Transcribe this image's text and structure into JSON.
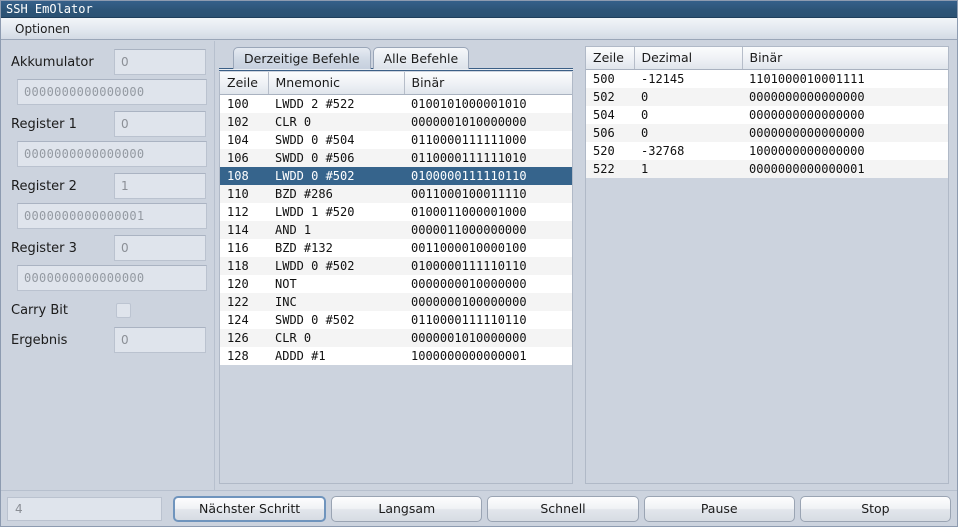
{
  "window": {
    "title": "SSH EmOlator"
  },
  "menubar": {
    "items": [
      {
        "label": "Optionen"
      }
    ]
  },
  "registers": {
    "rows": [
      {
        "label": "Akkumulator",
        "value": "0",
        "binary": "0000000000000000"
      },
      {
        "label": "Register 1",
        "value": "0",
        "binary": "0000000000000000"
      },
      {
        "label": "Register 2",
        "value": "1",
        "binary": "0000000000000001"
      },
      {
        "label": "Register 3",
        "value": "0",
        "binary": "0000000000000000"
      }
    ],
    "carry": {
      "label": "Carry Bit",
      "checked": false
    },
    "result": {
      "label": "Ergebnis",
      "value": "0"
    }
  },
  "tabs": [
    {
      "label": "Derzeitige Befehle",
      "active": true
    },
    {
      "label": "Alle Befehle",
      "active": false
    }
  ],
  "instructions": {
    "headers": [
      "Zeile",
      "Mnemonic",
      "Binär"
    ],
    "rows": [
      {
        "zeile": "100",
        "mnemonic": "LWDD 2 #522",
        "binaer": "0100101000001010",
        "selected": false
      },
      {
        "zeile": "102",
        "mnemonic": "CLR 0",
        "binaer": "0000001010000000",
        "selected": false
      },
      {
        "zeile": "104",
        "mnemonic": "SWDD 0 #504",
        "binaer": "0110000111111000",
        "selected": false
      },
      {
        "zeile": "106",
        "mnemonic": "SWDD 0 #506",
        "binaer": "0110000111111010",
        "selected": false
      },
      {
        "zeile": "108",
        "mnemonic": "LWDD 0 #502",
        "binaer": "0100000111110110",
        "selected": true
      },
      {
        "zeile": "110",
        "mnemonic": "BZD #286",
        "binaer": "0011000100011110",
        "selected": false
      },
      {
        "zeile": "112",
        "mnemonic": "LWDD 1 #520",
        "binaer": "0100011000001000",
        "selected": false
      },
      {
        "zeile": "114",
        "mnemonic": "AND 1",
        "binaer": "0000011000000000",
        "selected": false
      },
      {
        "zeile": "116",
        "mnemonic": "BZD #132",
        "binaer": "0011000010000100",
        "selected": false
      },
      {
        "zeile": "118",
        "mnemonic": "LWDD 0 #502",
        "binaer": "0100000111110110",
        "selected": false
      },
      {
        "zeile": "120",
        "mnemonic": "NOT",
        "binaer": "0000000010000000",
        "selected": false
      },
      {
        "zeile": "122",
        "mnemonic": "INC",
        "binaer": "0000000100000000",
        "selected": false
      },
      {
        "zeile": "124",
        "mnemonic": "SWDD 0 #502",
        "binaer": "0110000111110110",
        "selected": false
      },
      {
        "zeile": "126",
        "mnemonic": "CLR 0",
        "binaer": "0000001010000000",
        "selected": false
      },
      {
        "zeile": "128",
        "mnemonic": "ADDD #1",
        "binaer": "1000000000000001",
        "selected": false
      }
    ]
  },
  "memory": {
    "headers": [
      "Zeile",
      "Dezimal",
      "Binär"
    ],
    "rows": [
      {
        "zeile": "500",
        "dezimal": "-12145",
        "binaer": "1101000010001111"
      },
      {
        "zeile": "502",
        "dezimal": "0",
        "binaer": "0000000000000000"
      },
      {
        "zeile": "504",
        "dezimal": "0",
        "binaer": "0000000000000000"
      },
      {
        "zeile": "506",
        "dezimal": "0",
        "binaer": "0000000000000000"
      },
      {
        "zeile": "520",
        "dezimal": "-32768",
        "binaer": "1000000000000000"
      },
      {
        "zeile": "522",
        "dezimal": "1",
        "binaer": "0000000000000001"
      }
    ]
  },
  "bottombar": {
    "status_value": "4",
    "buttons": [
      {
        "label": "Nächster Schritt",
        "focused": true
      },
      {
        "label": "Langsam",
        "focused": false
      },
      {
        "label": "Schnell",
        "focused": false
      },
      {
        "label": "Pause",
        "focused": false
      },
      {
        "label": "Stop",
        "focused": false
      }
    ]
  },
  "colors": {
    "titlebar": "#2d5578",
    "selection": "#36648c",
    "panel": "#ccd3de",
    "field": "#dfe4ec",
    "row_even": "#ffffff",
    "row_odd": "#f4f4f4"
  }
}
